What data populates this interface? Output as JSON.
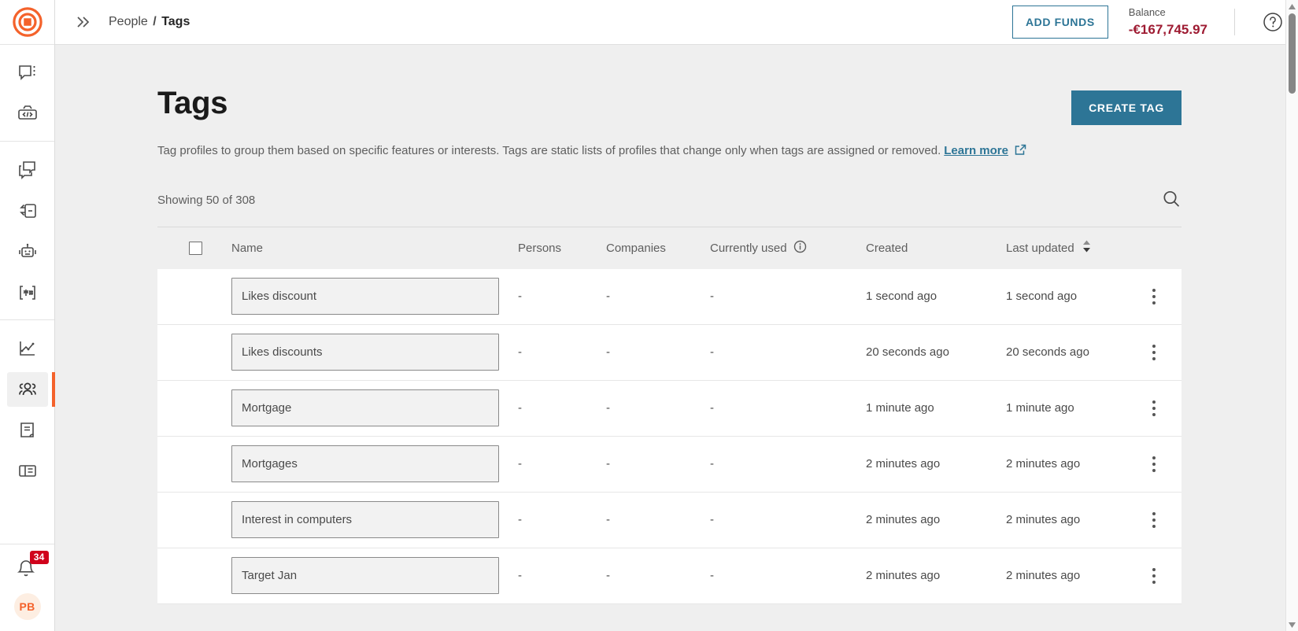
{
  "sidebar": {
    "logo": "target-logo",
    "groups": [
      {
        "items": [
          {
            "name": "chat-menu-icon",
            "label": "Conversations"
          },
          {
            "name": "code-box-icon",
            "label": "Developer"
          }
        ]
      },
      {
        "items": [
          {
            "name": "campaigns-icon",
            "label": "Campaigns"
          },
          {
            "name": "templates-icon",
            "label": "Templates"
          },
          {
            "name": "automation-robot-icon",
            "label": "Automations"
          },
          {
            "name": "snippets-hash-icon",
            "label": "Snippets"
          }
        ]
      },
      {
        "items": [
          {
            "name": "analytics-chart-icon",
            "label": "Analytics"
          },
          {
            "name": "people-icon",
            "label": "People",
            "active": true
          },
          {
            "name": "content-book-icon",
            "label": "Content"
          },
          {
            "name": "layout-panel-icon",
            "label": "Layouts"
          }
        ]
      }
    ],
    "notifications": {
      "icon": "bell-icon",
      "badge": "34"
    },
    "avatar": {
      "initials": "PB"
    }
  },
  "topbar": {
    "collapse_icon": "double-chevron-right-icon",
    "breadcrumb": {
      "parent": "People",
      "separator": "/",
      "current": "Tags"
    },
    "add_funds_label": "ADD FUNDS",
    "balance_label": "Balance",
    "balance_value": "-€167,745.97",
    "help_icon": "question-circle-icon"
  },
  "page": {
    "title": "Tags",
    "create_button_label": "CREATE TAG",
    "description": "Tag profiles to group them based on specific features or interests. Tags are static lists of profiles that change only when tags are assigned or removed.",
    "learn_more_label": "Learn more",
    "external_link_icon": "external-link-icon",
    "showing_text": "Showing 50 of 308",
    "search_icon": "search-icon"
  },
  "table": {
    "columns": {
      "select_all": "",
      "name": "Name",
      "persons": "Persons",
      "companies": "Companies",
      "currently_used": "Currently used",
      "currently_used_info_icon": "info-circle-icon",
      "created": "Created",
      "last_updated": "Last updated",
      "sort_icon": "sort-arrows-icon"
    },
    "rows": [
      {
        "name": "Likes discount",
        "persons": "-",
        "companies": "-",
        "currently_used": "-",
        "created": "1 second ago",
        "last_updated": "1 second ago"
      },
      {
        "name": "Likes discounts",
        "persons": "-",
        "companies": "-",
        "currently_used": "-",
        "created": "20 seconds ago",
        "last_updated": "20 seconds ago"
      },
      {
        "name": "Mortgage",
        "persons": "-",
        "companies": "-",
        "currently_used": "-",
        "created": "1 minute ago",
        "last_updated": "1 minute ago"
      },
      {
        "name": "Mortgages",
        "persons": "-",
        "companies": "-",
        "currently_used": "-",
        "created": "2 minutes ago",
        "last_updated": "2 minutes ago"
      },
      {
        "name": "Interest in computers",
        "persons": "-",
        "companies": "-",
        "currently_used": "-",
        "created": "2 minutes ago",
        "last_updated": "2 minutes ago"
      },
      {
        "name": "Target Jan",
        "persons": "-",
        "companies": "-",
        "currently_used": "-",
        "created": "2 minutes ago",
        "last_updated": "2 minutes ago"
      }
    ],
    "row_menu_icon": "kebab-menu-icon"
  },
  "colors": {
    "brand_orange": "#f4622b",
    "accent_teal": "#2d7596",
    "balance_negative": "#9e1b32",
    "badge_red": "#d0021b",
    "content_bg": "#efefef"
  }
}
